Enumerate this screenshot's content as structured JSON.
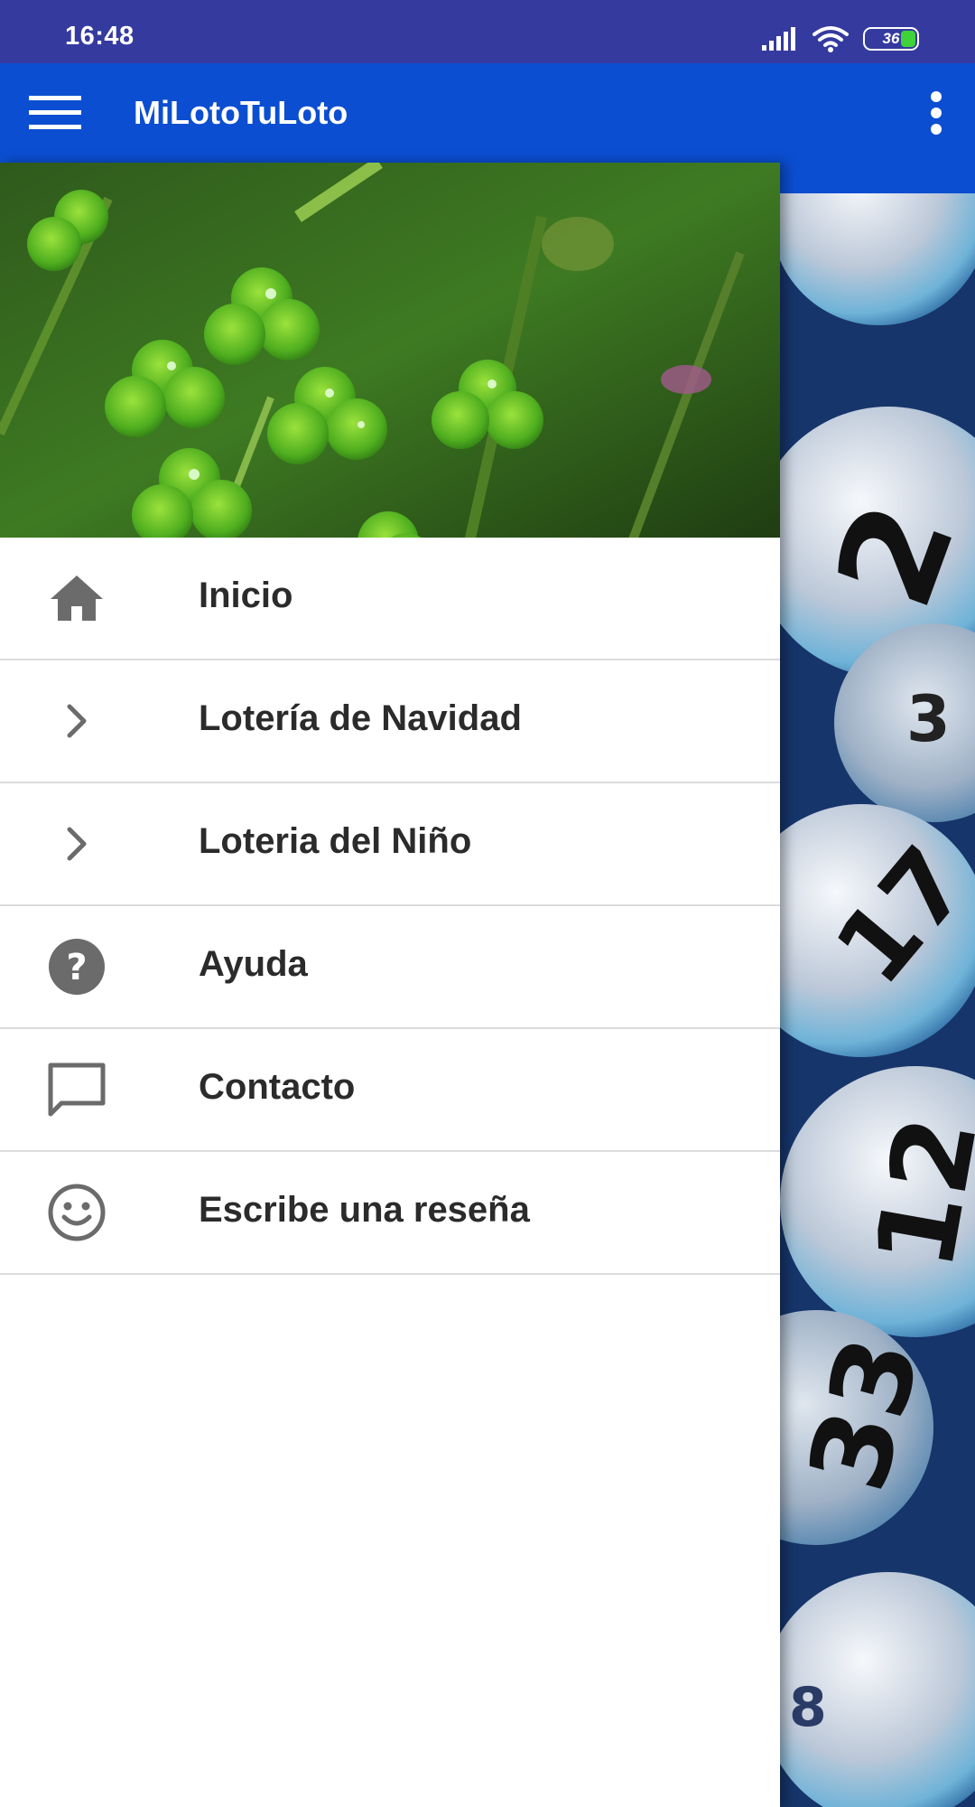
{
  "status_bar": {
    "time": "16:48",
    "battery_level": "36",
    "icons": [
      "signal-icon",
      "wifi-icon",
      "battery-icon"
    ],
    "battery_fill_color": "#3fd23a"
  },
  "app_bar": {
    "title": "MiLotoTuLoto",
    "background_color": "#0b4ed1",
    "icons": [
      "hamburger-menu-icon",
      "more-vert-icon"
    ]
  },
  "drawer": {
    "header_image": "four-leaf-clover-photo",
    "items": [
      {
        "label": "Inicio",
        "icon": "home-icon"
      },
      {
        "label": "Lotería de Navidad",
        "icon": "chevron-right-icon"
      },
      {
        "label": "Loteria del Niño",
        "icon": "chevron-right-icon"
      },
      {
        "label": "Ayuda",
        "icon": "help-circle-icon"
      },
      {
        "label": "Contacto",
        "icon": "message-icon"
      },
      {
        "label": "Escribe una reseña",
        "icon": "smiley-face-icon"
      }
    ]
  },
  "background": {
    "image": "lottery-balls-photo"
  },
  "colors": {
    "status_bar": "#353a9f",
    "app_bar": "#0b4ed1",
    "icon_gray": "#6b6b6b",
    "text_dark": "#2b2b2b",
    "divider": "#dcdcdc"
  }
}
